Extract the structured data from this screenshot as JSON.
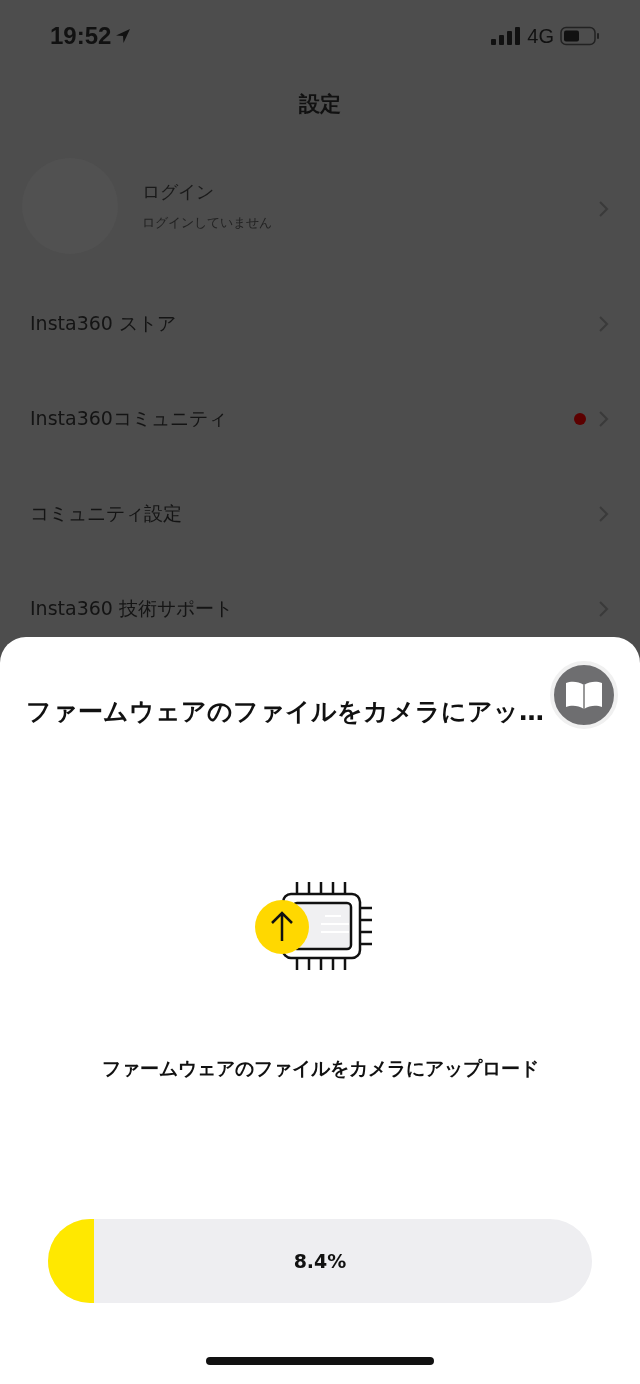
{
  "status_bar": {
    "time": "19:52",
    "network": "4G"
  },
  "header": {
    "title": "設定"
  },
  "account": {
    "title": "ログイン",
    "subtitle": "ログインしていません"
  },
  "menu_items": [
    {
      "label": "Insta360 ストア",
      "dot": false
    },
    {
      "label": "Insta360コミュニティ",
      "dot": true
    },
    {
      "label": "コミュニティ設定",
      "dot": false
    },
    {
      "label": "Insta360 技術サポート",
      "dot": false
    }
  ],
  "sheet": {
    "title": "ファームウェアのファイルをカメラにアッ…",
    "message": "ファームウェアのファイルをカメラにアップロード",
    "progress": {
      "level": 0.084,
      "reading": "8.4%"
    }
  }
}
